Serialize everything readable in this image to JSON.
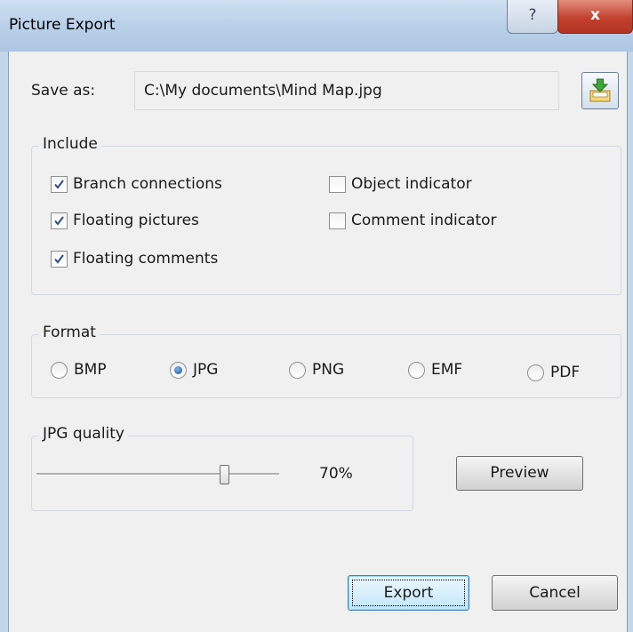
{
  "window": {
    "title": "Picture Export",
    "help_glyph": "?",
    "close_glyph": "x"
  },
  "save_as": {
    "label": "Save as:",
    "path": "C:\\My documents\\Mind Map.jpg",
    "browse_icon": "folder-save-icon"
  },
  "include": {
    "label": "Include",
    "options": [
      {
        "label": "Branch connections",
        "checked": true
      },
      {
        "label": "Floating pictures",
        "checked": true
      },
      {
        "label": "Floating comments",
        "checked": true
      },
      {
        "label": "Object indicator",
        "checked": false
      },
      {
        "label": "Comment indicator",
        "checked": false
      }
    ]
  },
  "format": {
    "label": "Format",
    "options": [
      {
        "label": "BMP",
        "selected": false
      },
      {
        "label": "JPG",
        "selected": true
      },
      {
        "label": "PNG",
        "selected": false
      },
      {
        "label": "EMF",
        "selected": false
      },
      {
        "label": "PDF",
        "selected": false
      }
    ]
  },
  "quality": {
    "label": "JPG quality",
    "value_text": "70%",
    "value": 0.7
  },
  "buttons": {
    "preview": "Preview",
    "export": "Export",
    "cancel": "Cancel"
  },
  "colors": {
    "titlebar": "#bcd2ea",
    "dialog_bg": "#f0f0f0",
    "close_button": "#c2402e",
    "default_button_border": "#3c7fb1"
  }
}
